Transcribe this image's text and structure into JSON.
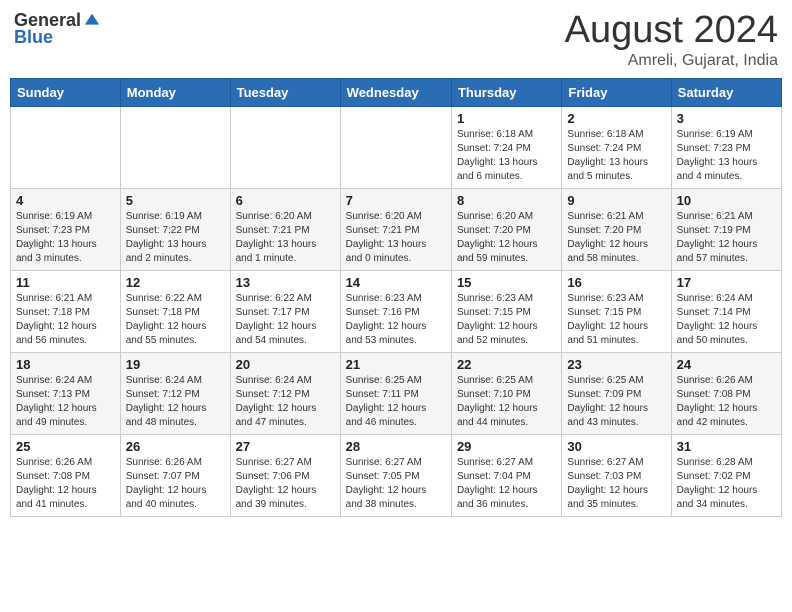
{
  "header": {
    "logo_general": "General",
    "logo_blue": "Blue",
    "month_year": "August 2024",
    "location": "Amreli, Gujarat, India"
  },
  "days_of_week": [
    "Sunday",
    "Monday",
    "Tuesday",
    "Wednesday",
    "Thursday",
    "Friday",
    "Saturday"
  ],
  "weeks": [
    [
      {
        "day": "",
        "info": ""
      },
      {
        "day": "",
        "info": ""
      },
      {
        "day": "",
        "info": ""
      },
      {
        "day": "",
        "info": ""
      },
      {
        "day": "1",
        "info": "Sunrise: 6:18 AM\nSunset: 7:24 PM\nDaylight: 13 hours\nand 6 minutes."
      },
      {
        "day": "2",
        "info": "Sunrise: 6:18 AM\nSunset: 7:24 PM\nDaylight: 13 hours\nand 5 minutes."
      },
      {
        "day": "3",
        "info": "Sunrise: 6:19 AM\nSunset: 7:23 PM\nDaylight: 13 hours\nand 4 minutes."
      }
    ],
    [
      {
        "day": "4",
        "info": "Sunrise: 6:19 AM\nSunset: 7:23 PM\nDaylight: 13 hours\nand 3 minutes."
      },
      {
        "day": "5",
        "info": "Sunrise: 6:19 AM\nSunset: 7:22 PM\nDaylight: 13 hours\nand 2 minutes."
      },
      {
        "day": "6",
        "info": "Sunrise: 6:20 AM\nSunset: 7:21 PM\nDaylight: 13 hours\nand 1 minute."
      },
      {
        "day": "7",
        "info": "Sunrise: 6:20 AM\nSunset: 7:21 PM\nDaylight: 13 hours\nand 0 minutes."
      },
      {
        "day": "8",
        "info": "Sunrise: 6:20 AM\nSunset: 7:20 PM\nDaylight: 12 hours\nand 59 minutes."
      },
      {
        "day": "9",
        "info": "Sunrise: 6:21 AM\nSunset: 7:20 PM\nDaylight: 12 hours\nand 58 minutes."
      },
      {
        "day": "10",
        "info": "Sunrise: 6:21 AM\nSunset: 7:19 PM\nDaylight: 12 hours\nand 57 minutes."
      }
    ],
    [
      {
        "day": "11",
        "info": "Sunrise: 6:21 AM\nSunset: 7:18 PM\nDaylight: 12 hours\nand 56 minutes."
      },
      {
        "day": "12",
        "info": "Sunrise: 6:22 AM\nSunset: 7:18 PM\nDaylight: 12 hours\nand 55 minutes."
      },
      {
        "day": "13",
        "info": "Sunrise: 6:22 AM\nSunset: 7:17 PM\nDaylight: 12 hours\nand 54 minutes."
      },
      {
        "day": "14",
        "info": "Sunrise: 6:23 AM\nSunset: 7:16 PM\nDaylight: 12 hours\nand 53 minutes."
      },
      {
        "day": "15",
        "info": "Sunrise: 6:23 AM\nSunset: 7:15 PM\nDaylight: 12 hours\nand 52 minutes."
      },
      {
        "day": "16",
        "info": "Sunrise: 6:23 AM\nSunset: 7:15 PM\nDaylight: 12 hours\nand 51 minutes."
      },
      {
        "day": "17",
        "info": "Sunrise: 6:24 AM\nSunset: 7:14 PM\nDaylight: 12 hours\nand 50 minutes."
      }
    ],
    [
      {
        "day": "18",
        "info": "Sunrise: 6:24 AM\nSunset: 7:13 PM\nDaylight: 12 hours\nand 49 minutes."
      },
      {
        "day": "19",
        "info": "Sunrise: 6:24 AM\nSunset: 7:12 PM\nDaylight: 12 hours\nand 48 minutes."
      },
      {
        "day": "20",
        "info": "Sunrise: 6:24 AM\nSunset: 7:12 PM\nDaylight: 12 hours\nand 47 minutes."
      },
      {
        "day": "21",
        "info": "Sunrise: 6:25 AM\nSunset: 7:11 PM\nDaylight: 12 hours\nand 46 minutes."
      },
      {
        "day": "22",
        "info": "Sunrise: 6:25 AM\nSunset: 7:10 PM\nDaylight: 12 hours\nand 44 minutes."
      },
      {
        "day": "23",
        "info": "Sunrise: 6:25 AM\nSunset: 7:09 PM\nDaylight: 12 hours\nand 43 minutes."
      },
      {
        "day": "24",
        "info": "Sunrise: 6:26 AM\nSunset: 7:08 PM\nDaylight: 12 hours\nand 42 minutes."
      }
    ],
    [
      {
        "day": "25",
        "info": "Sunrise: 6:26 AM\nSunset: 7:08 PM\nDaylight: 12 hours\nand 41 minutes."
      },
      {
        "day": "26",
        "info": "Sunrise: 6:26 AM\nSunset: 7:07 PM\nDaylight: 12 hours\nand 40 minutes."
      },
      {
        "day": "27",
        "info": "Sunrise: 6:27 AM\nSunset: 7:06 PM\nDaylight: 12 hours\nand 39 minutes."
      },
      {
        "day": "28",
        "info": "Sunrise: 6:27 AM\nSunset: 7:05 PM\nDaylight: 12 hours\nand 38 minutes."
      },
      {
        "day": "29",
        "info": "Sunrise: 6:27 AM\nSunset: 7:04 PM\nDaylight: 12 hours\nand 36 minutes."
      },
      {
        "day": "30",
        "info": "Sunrise: 6:27 AM\nSunset: 7:03 PM\nDaylight: 12 hours\nand 35 minutes."
      },
      {
        "day": "31",
        "info": "Sunrise: 6:28 AM\nSunset: 7:02 PM\nDaylight: 12 hours\nand 34 minutes."
      }
    ]
  ]
}
